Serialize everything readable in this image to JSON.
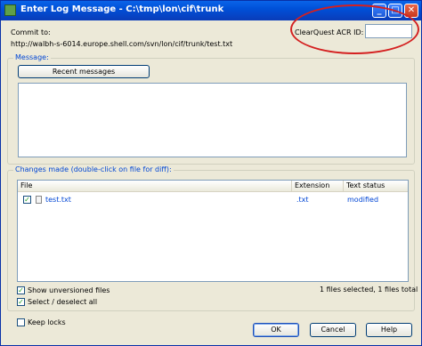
{
  "window": {
    "title": "Enter Log Message - C:\\tmp\\lon\\cif\\trunk",
    "minimize_glyph": "_",
    "maximize_glyph": "□",
    "close_glyph": "✕"
  },
  "commit": {
    "label": "Commit to:",
    "url": "http://walbh-s-6014.europe.shell.com/svn/lon/cif/trunk/test.txt"
  },
  "acr": {
    "label": "ClearQuest ACR ID:",
    "value": ""
  },
  "message": {
    "group_label": "Message:",
    "recent_button": "Recent messages",
    "text": ""
  },
  "changes": {
    "group_label": "Changes made (double-click on file for diff):",
    "columns": [
      "File",
      "Extension",
      "Text status"
    ],
    "rows": [
      {
        "checked": true,
        "file": "test.txt",
        "extension": ".txt",
        "status": "modified"
      }
    ],
    "show_unversioned_label": "Show unversioned files",
    "select_all_label": "Select / deselect all",
    "selection_status": "1 files selected, 1 files total"
  },
  "footer": {
    "keep_locks_label": "Keep locks",
    "ok_label": "OK",
    "cancel_label": "Cancel",
    "help_label": "Help"
  },
  "colors": {
    "title_bar": "#0a5ad8",
    "group_label": "#0046d5",
    "highlight_ellipse": "#d42020"
  },
  "check_glyph": "✓"
}
